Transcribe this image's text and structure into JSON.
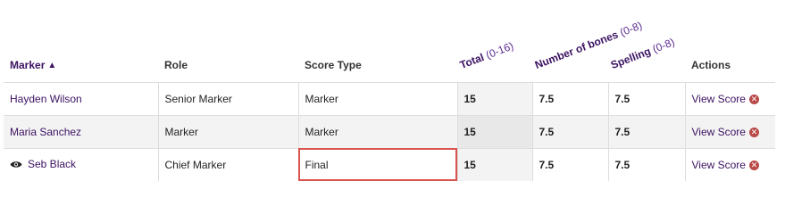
{
  "headers": {
    "marker": "Marker",
    "role": "Role",
    "score_type": "Score Type",
    "total": "Total",
    "total_range": "(0-16)",
    "bones": "Number of bones",
    "bones_range": "(0-8)",
    "spelling": "Spelling",
    "spelling_range": "(0-8)",
    "actions": "Actions"
  },
  "rows": [
    {
      "marker": "Hayden Wilson",
      "role": "Senior Marker",
      "score_type": "Marker",
      "total": "15",
      "bones": "7.5",
      "spelling": "7.5",
      "action": "View Score"
    },
    {
      "marker": "Maria Sanchez",
      "role": "Marker",
      "score_type": "Marker",
      "total": "15",
      "bones": "7.5",
      "spelling": "7.5",
      "action": "View Score"
    },
    {
      "marker": "Seb Black",
      "role": "Chief Marker",
      "score_type": "Final",
      "total": "15",
      "bones": "7.5",
      "spelling": "7.5",
      "action": "View Score"
    }
  ],
  "icons": {
    "sort": "chevron-up-icon",
    "eye": "eye-icon",
    "remove": "remove-circle-icon"
  },
  "colors": {
    "link": "#3b1262",
    "highlight": "#d9534f",
    "remove": "#b94a48"
  }
}
